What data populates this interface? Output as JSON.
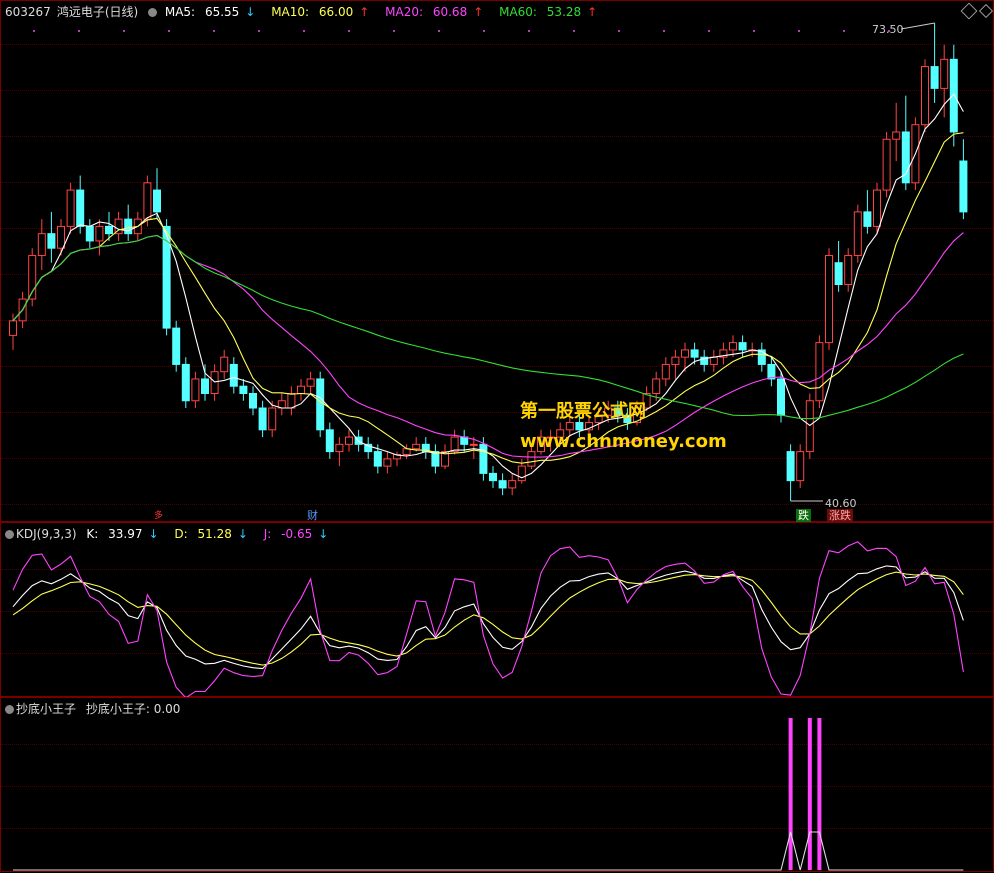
{
  "header": {
    "code": "603267",
    "name": "鸿远电子",
    "period": "(日线)",
    "ma": [
      {
        "label": "MA5:",
        "value": "65.55",
        "arrow": "↓",
        "color": "#ffffff"
      },
      {
        "label": "MA10:",
        "value": "66.00",
        "arrow": "↑",
        "color": "#ffff55"
      },
      {
        "label": "MA20:",
        "value": "60.68",
        "arrow": "↑",
        "color": "#ff44ff"
      },
      {
        "label": "MA60:",
        "value": "53.28",
        "arrow": "↑",
        "color": "#33dd33"
      }
    ]
  },
  "annotations": {
    "high": "73.50",
    "low": "40.60",
    "tag_cai": "财",
    "tag_die": "跌",
    "tag_hulv": "涨跌",
    "tag_left": "多"
  },
  "kdj": {
    "title": "KDJ(9,3,3)",
    "k_label": "K:",
    "k_value": "33.97",
    "k_arrow": "↓",
    "d_label": "D:",
    "d_value": "51.28",
    "d_arrow": "↓",
    "j_label": "J:",
    "j_value": "-0.65",
    "j_arrow": "↓"
  },
  "cdx": {
    "title": "抄底小王子",
    "series_label": "抄底小王子:",
    "value": "0.00"
  },
  "watermark": {
    "line1": "第一股票公式网",
    "line2": "www.chnmoney.com"
  },
  "colors": {
    "up": "#ff4444",
    "down": "#55ffff",
    "ma5": "#ffffff",
    "ma10": "#ffff55",
    "ma20": "#ff44ff",
    "ma60": "#33dd33",
    "k": "#ffffff",
    "d": "#ffff55",
    "j": "#ff44ff",
    "signal": "#ff44ff"
  },
  "chart_data": [
    {
      "type": "candlestick",
      "title": "603267 鸿远电子 (日线)",
      "price_range": [
        40.6,
        73.5
      ],
      "candles": [
        [
          52.0,
          53.5,
          51.0,
          53.0
        ],
        [
          53.0,
          55.0,
          52.5,
          54.5
        ],
        [
          54.5,
          58.0,
          54.0,
          57.5
        ],
        [
          57.5,
          60.0,
          56.5,
          59.0
        ],
        [
          59.0,
          60.5,
          57.0,
          58.0
        ],
        [
          58.0,
          60.0,
          57.5,
          59.5
        ],
        [
          59.5,
          62.5,
          59.0,
          62.0
        ],
        [
          62.0,
          63.0,
          59.0,
          59.5
        ],
        [
          59.5,
          60.0,
          58.0,
          58.5
        ],
        [
          58.5,
          60.0,
          57.5,
          59.5
        ],
        [
          59.5,
          60.5,
          58.5,
          59.0
        ],
        [
          59.0,
          60.5,
          58.5,
          60.0
        ],
        [
          60.0,
          61.0,
          58.5,
          59.0
        ],
        [
          59.0,
          60.5,
          58.5,
          60.0
        ],
        [
          60.0,
          63.0,
          59.5,
          62.5
        ],
        [
          62.0,
          63.5,
          60.0,
          60.5
        ],
        [
          59.5,
          60.0,
          52.0,
          52.5
        ],
        [
          52.5,
          53.0,
          49.5,
          50.0
        ],
        [
          50.0,
          50.5,
          47.0,
          47.5
        ],
        [
          47.5,
          49.5,
          47.0,
          49.0
        ],
        [
          49.0,
          50.0,
          47.5,
          48.0
        ],
        [
          48.0,
          50.0,
          47.5,
          49.5
        ],
        [
          49.5,
          51.0,
          49.0,
          50.5
        ],
        [
          50.0,
          50.5,
          48.0,
          48.5
        ],
        [
          48.5,
          49.0,
          47.5,
          48.0
        ],
        [
          48.0,
          48.5,
          46.5,
          47.0
        ],
        [
          47.0,
          47.5,
          45.0,
          45.5
        ],
        [
          45.5,
          47.5,
          45.0,
          47.0
        ],
        [
          47.0,
          48.0,
          46.5,
          47.5
        ],
        [
          47.0,
          48.5,
          46.5,
          48.0
        ],
        [
          48.0,
          49.0,
          47.5,
          48.5
        ],
        [
          48.5,
          49.5,
          48.0,
          49.0
        ],
        [
          49.0,
          49.5,
          45.0,
          45.5
        ],
        [
          45.5,
          46.0,
          43.5,
          44.0
        ],
        [
          44.0,
          45.0,
          43.0,
          44.5
        ],
        [
          44.5,
          45.5,
          44.0,
          45.0
        ],
        [
          45.0,
          45.5,
          44.0,
          44.5
        ],
        [
          44.5,
          45.0,
          43.5,
          44.0
        ],
        [
          44.0,
          44.5,
          42.5,
          43.0
        ],
        [
          43.0,
          44.0,
          42.5,
          43.5
        ],
        [
          43.5,
          44.0,
          43.0,
          43.8
        ],
        [
          43.8,
          44.5,
          43.5,
          44.2
        ],
        [
          44.2,
          45.0,
          44.0,
          44.5
        ],
        [
          44.5,
          45.0,
          43.5,
          44.0
        ],
        [
          44.0,
          44.5,
          42.5,
          43.0
        ],
        [
          43.0,
          44.5,
          42.8,
          44.0
        ],
        [
          44.0,
          45.5,
          43.8,
          45.0
        ],
        [
          45.0,
          45.5,
          44.0,
          44.5
        ],
        [
          44.5,
          45.0,
          43.5,
          44.5
        ],
        [
          44.5,
          45.0,
          42.0,
          42.5
        ],
        [
          42.5,
          43.0,
          41.5,
          42.0
        ],
        [
          42.0,
          42.5,
          41.0,
          41.5
        ],
        [
          41.5,
          42.5,
          41.0,
          42.0
        ],
        [
          42.0,
          43.5,
          41.8,
          43.0
        ],
        [
          43.0,
          44.5,
          42.8,
          44.0
        ],
        [
          44.0,
          45.5,
          43.8,
          45.0
        ],
        [
          45.0,
          45.5,
          44.0,
          45.0
        ],
        [
          45.0,
          46.0,
          44.5,
          45.5
        ],
        [
          45.5,
          46.5,
          45.0,
          46.0
        ],
        [
          46.0,
          46.5,
          45.0,
          45.5
        ],
        [
          45.5,
          46.5,
          45.0,
          46.0
        ],
        [
          46.0,
          47.0,
          45.5,
          46.5
        ],
        [
          46.5,
          47.5,
          46.0,
          47.0
        ],
        [
          47.0,
          47.5,
          46.0,
          46.5
        ],
        [
          46.5,
          47.0,
          45.5,
          46.0
        ],
        [
          46.0,
          47.5,
          45.8,
          47.0
        ],
        [
          47.0,
          48.5,
          46.8,
          48.0
        ],
        [
          48.0,
          49.5,
          47.5,
          49.0
        ],
        [
          49.0,
          50.5,
          48.5,
          50.0
        ],
        [
          50.0,
          51.0,
          49.0,
          50.5
        ],
        [
          50.5,
          51.5,
          49.5,
          51.0
        ],
        [
          51.0,
          51.5,
          50.0,
          50.5
        ],
        [
          50.5,
          51.0,
          49.5,
          50.0
        ],
        [
          50.0,
          51.0,
          49.5,
          50.5
        ],
        [
          50.5,
          51.5,
          50.0,
          51.0
        ],
        [
          51.0,
          52.0,
          50.5,
          51.5
        ],
        [
          51.5,
          52.0,
          50.5,
          51.0
        ],
        [
          51.0,
          51.5,
          50.5,
          51.0
        ],
        [
          51.0,
          51.5,
          49.5,
          50.0
        ],
        [
          50.0,
          50.5,
          48.5,
          49.0
        ],
        [
          49.0,
          49.5,
          46.0,
          46.5
        ],
        [
          44.0,
          44.5,
          40.6,
          42.0
        ],
        [
          42.0,
          44.5,
          41.5,
          44.0
        ],
        [
          44.0,
          48.0,
          43.5,
          47.5
        ],
        [
          47.5,
          52.0,
          47.0,
          51.5
        ],
        [
          51.5,
          58.0,
          51.0,
          57.5
        ],
        [
          57.0,
          58.5,
          55.0,
          55.5
        ],
        [
          55.5,
          58.0,
          55.0,
          57.5
        ],
        [
          57.5,
          61.0,
          57.0,
          60.5
        ],
        [
          60.5,
          62.0,
          59.0,
          59.5
        ],
        [
          59.5,
          62.5,
          59.0,
          62.0
        ],
        [
          62.0,
          66.0,
          61.5,
          65.5
        ],
        [
          65.5,
          68.0,
          64.0,
          66.0
        ],
        [
          66.0,
          68.5,
          62.0,
          62.5
        ],
        [
          62.5,
          67.0,
          62.0,
          66.5
        ],
        [
          66.5,
          71.0,
          66.0,
          70.5
        ],
        [
          70.5,
          73.5,
          68.0,
          69.0
        ],
        [
          69.0,
          72.0,
          67.0,
          71.0
        ],
        [
          71.0,
          72.0,
          65.0,
          66.0
        ],
        [
          64.0,
          65.5,
          60.0,
          60.5
        ]
      ],
      "ma": {
        "MA5": 65.55,
        "MA10": 66.0,
        "MA20": 60.68,
        "MA60": 53.28
      }
    },
    {
      "type": "line",
      "title": "KDJ(9,3,3)",
      "series": [
        {
          "name": "K",
          "last": 33.97
        },
        {
          "name": "D",
          "last": 51.28
        },
        {
          "name": "J",
          "last": -0.65
        }
      ]
    },
    {
      "type": "bar",
      "title": "抄底小王子",
      "series": [
        {
          "name": "抄底小王子",
          "last": 0.0
        }
      ]
    }
  ]
}
